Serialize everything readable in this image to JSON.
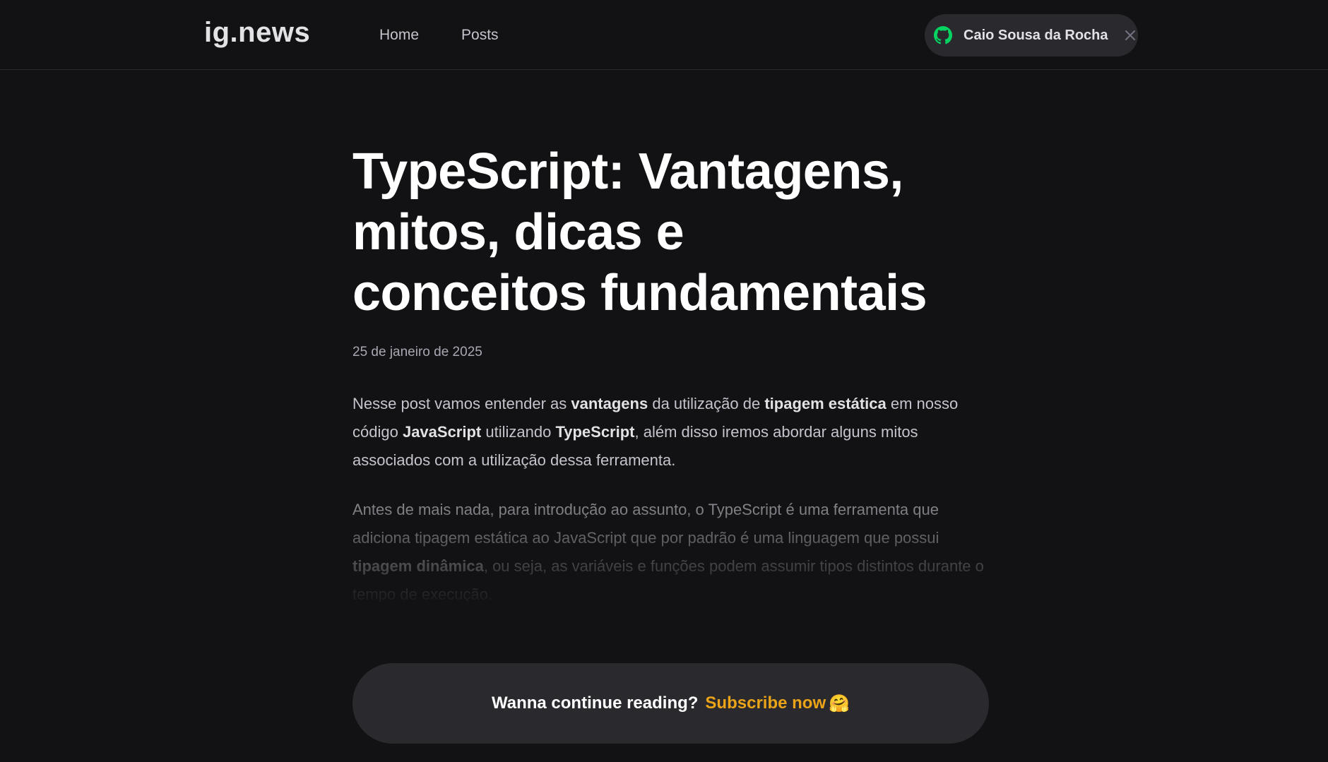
{
  "header": {
    "logo": "ig.news",
    "nav": [
      {
        "label": "Home"
      },
      {
        "label": "Posts"
      }
    ],
    "user": {
      "name": "Caio Sousa da Rocha",
      "icon": "github-icon",
      "icon_color": "#04d361"
    }
  },
  "post": {
    "title": "TypeScript: Vantagens, mitos, dicas e conceitos fundamentais",
    "date": "25 de janeiro de 2025",
    "p1": {
      "t1": "Nesse post vamos entender as ",
      "b1": "vantagens",
      "t2": " da utilização de ",
      "b2": "tipagem estática",
      "t3": " em nosso código ",
      "b3": "JavaScript",
      "t4": " utilizando ",
      "b4": "TypeScript",
      "t5": ", além disso iremos abordar alguns mitos associados com a utilização dessa ferramenta."
    },
    "p2": {
      "t1": "Antes de mais nada, para introdução ao assunto, o TypeScript é uma ferramenta que adiciona tipagem estática ao JavaScript que por padrão é uma linguagem que possui ",
      "b1": "tipagem dinâmica",
      "t2": ", ou seja, as variáveis e funções podem assumir tipos distintos durante o tempo de execução."
    }
  },
  "subscribe": {
    "question": "Wanna continue reading?",
    "link": "Subscribe now",
    "emoji": "🤗",
    "accent": "#eba417"
  }
}
